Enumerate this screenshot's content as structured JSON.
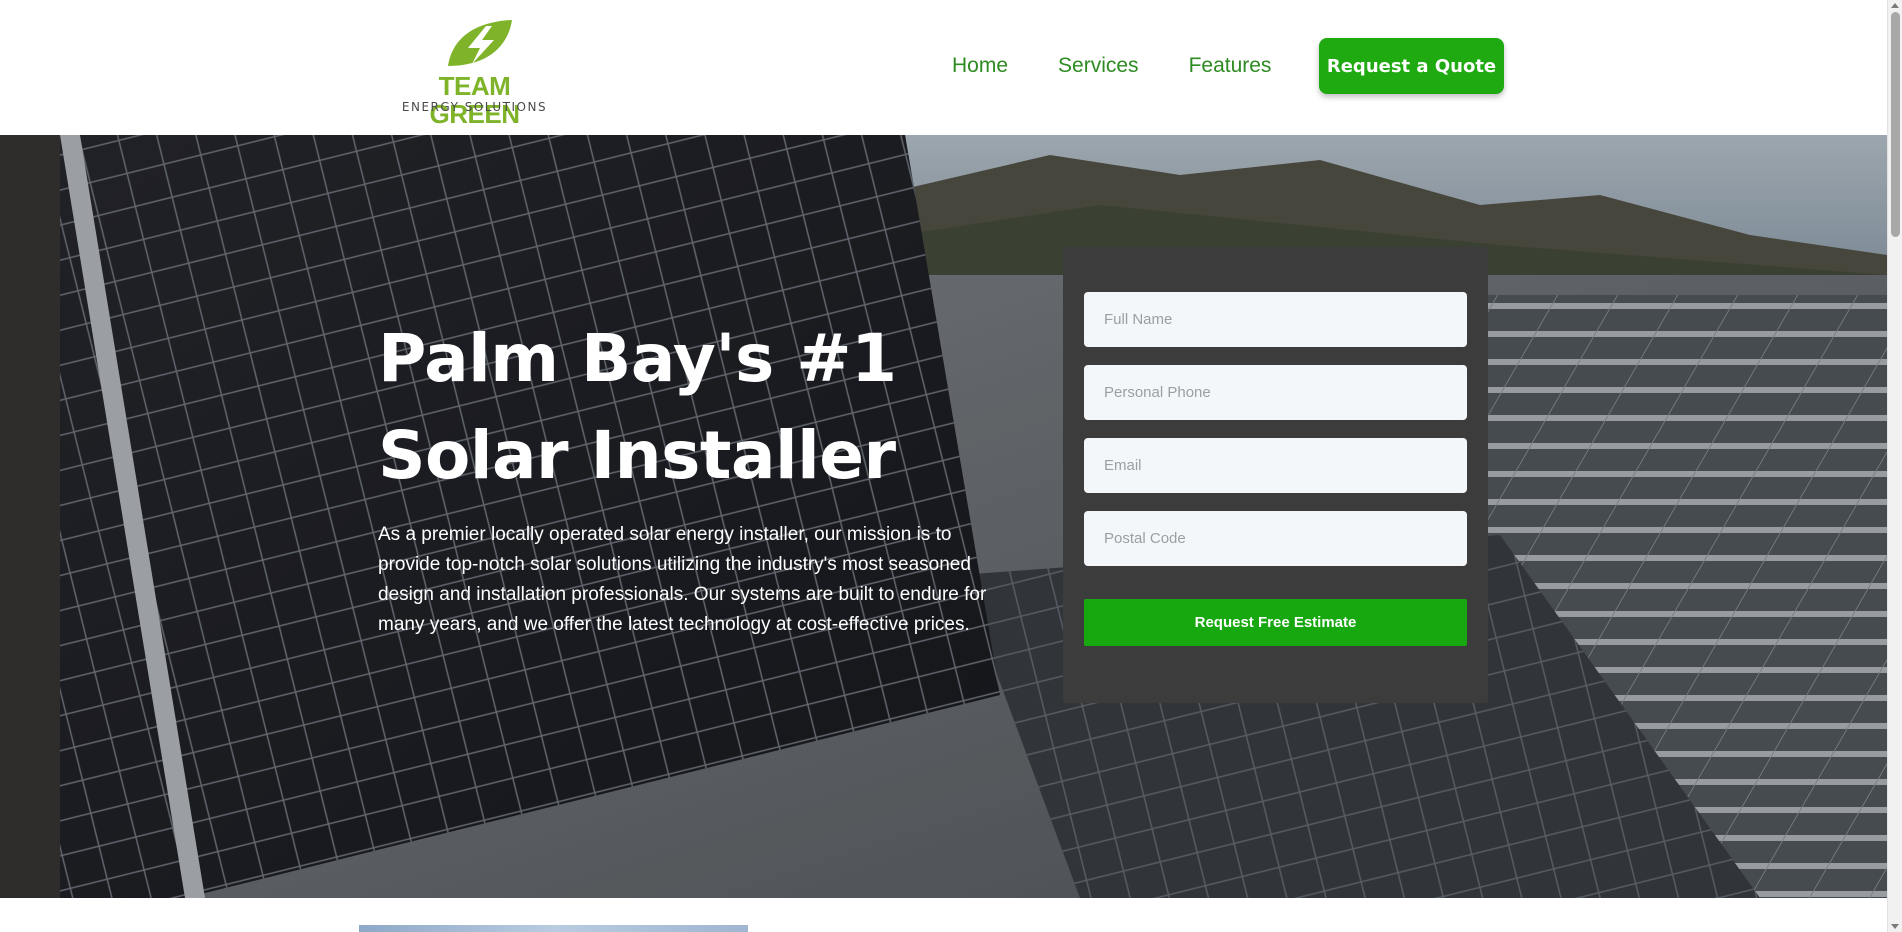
{
  "brand": {
    "name_line1": "TEAM GREEN",
    "name_line2": "ENERGY SOLUTIONS",
    "logo_icon": "lightning-leaf-icon",
    "primary_color": "#1faa12",
    "logo_green": "#7eb32a"
  },
  "nav": {
    "items": [
      {
        "label": "Home"
      },
      {
        "label": "Services"
      },
      {
        "label": "Features"
      }
    ],
    "cta_label": "Request a Quote"
  },
  "hero": {
    "title": "Palm Bay's #1 Solar Installer",
    "description": "As a premier locally operated solar energy installer, our mission is to provide top-notch solar solutions utilizing the industry's most seasoned design and installation professionals. Our systems are built to endure for many years, and we offer the latest technology at cost-effective prices.",
    "background": "solar-panels-on-rooftop-with-mountains-photo"
  },
  "form": {
    "fields": [
      {
        "placeholder": "Full Name",
        "value": ""
      },
      {
        "placeholder": "Personal Phone",
        "value": ""
      },
      {
        "placeholder": "Email",
        "value": ""
      },
      {
        "placeholder": "Postal Code",
        "value": ""
      }
    ],
    "submit_label": "Request Free Estimate"
  }
}
